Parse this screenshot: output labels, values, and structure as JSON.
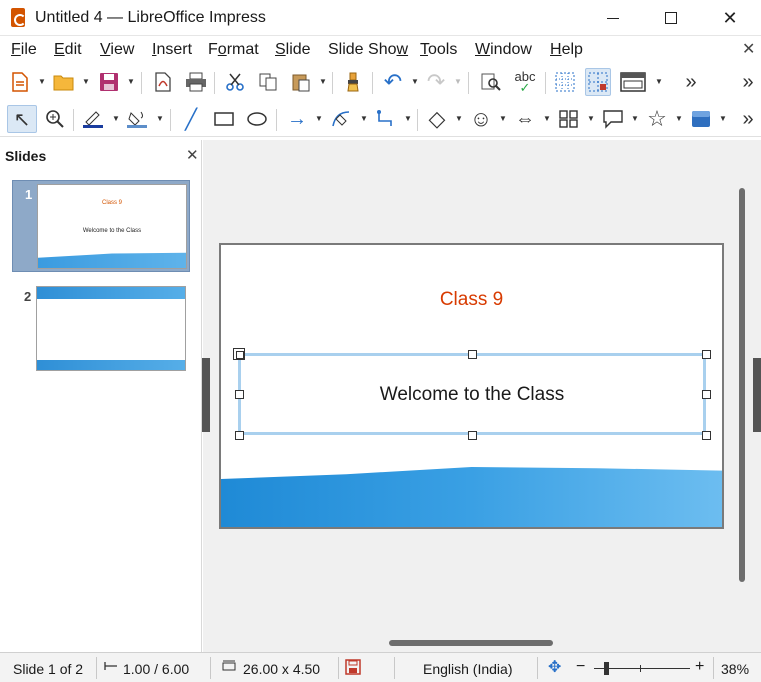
{
  "window": {
    "title": "Untitled 4 — LibreOffice Impress",
    "minimize_glyph": "",
    "close_glyph": "✕"
  },
  "menu": {
    "items": [
      {
        "label": "File",
        "hotkey": "F"
      },
      {
        "label": "Edit",
        "hotkey": "E"
      },
      {
        "label": "View",
        "hotkey": "V"
      },
      {
        "label": "Insert",
        "hotkey": "I"
      },
      {
        "label": "Format",
        "hotkey": "o"
      },
      {
        "label": "Slide",
        "hotkey": "S"
      },
      {
        "label": "Slide Show",
        "hotkey": "w"
      },
      {
        "label": "Tools",
        "hotkey": "T"
      },
      {
        "label": "Window",
        "hotkey": "W"
      },
      {
        "label": "Help",
        "hotkey": "H"
      }
    ],
    "close_glyph": "✕"
  },
  "toolbar1": {
    "icons": [
      "new-document-icon",
      "open-folder-icon",
      "save-icon",
      "export-pdf-icon",
      "print-icon",
      "cut-icon",
      "copy-icon",
      "paste-icon",
      "clone-formatting-icon",
      "undo-icon",
      "redo-icon",
      "find-replace-icon",
      "spelling-icon",
      "display-grid-icon",
      "helplines-icon",
      "slide-layout-icon",
      "more-icon",
      "overflow-icon"
    ],
    "glyphs": {
      "undo": "↶",
      "redo": "↷",
      "more": "»",
      "overflow": "»",
      "spell": "abc"
    }
  },
  "toolbar2": {
    "icons": [
      "select-icon",
      "zoom-pan-icon",
      "line-color-icon",
      "fill-color-icon",
      "line-icon",
      "rectangle-icon",
      "ellipse-icon",
      "arrow-line-icon",
      "curve-icon",
      "connector-icon",
      "basic-shapes-icon",
      "symbol-shapes-icon",
      "block-arrows-icon",
      "flowchart-icon",
      "callout-icon",
      "stars-icon",
      "3d-objects-icon",
      "overflow-icon"
    ],
    "glyphs": {
      "select": "↖",
      "zoom": "🔍",
      "line": "╱",
      "arrow": "→",
      "diamond": "◇",
      "smiley": "☺",
      "double-arrow": "⇔",
      "callout": "💬",
      "star": "☆",
      "overflow": "»"
    }
  },
  "slides_pane": {
    "title": "Slides",
    "close_glyph": "✕",
    "slides": [
      {
        "number": "1",
        "title": "Class 9",
        "subtitle": "Welcome to the Class",
        "selected": true
      },
      {
        "number": "2",
        "title": "",
        "subtitle": "",
        "selected": false
      }
    ]
  },
  "slide": {
    "title": "Class 9",
    "subtitle": "Welcome to the Class",
    "colors": {
      "title": "#d83b01",
      "wave": "#1f8ad6",
      "selection": "#a9d0ee"
    }
  },
  "statusbar": {
    "slide_info": "Slide 1 of 2",
    "position": "1.00 / 6.00",
    "size": "26.00 x 4.50",
    "language": "English (India)",
    "zoom_minus": "−",
    "zoom_plus": "+",
    "zoom": "38%"
  }
}
